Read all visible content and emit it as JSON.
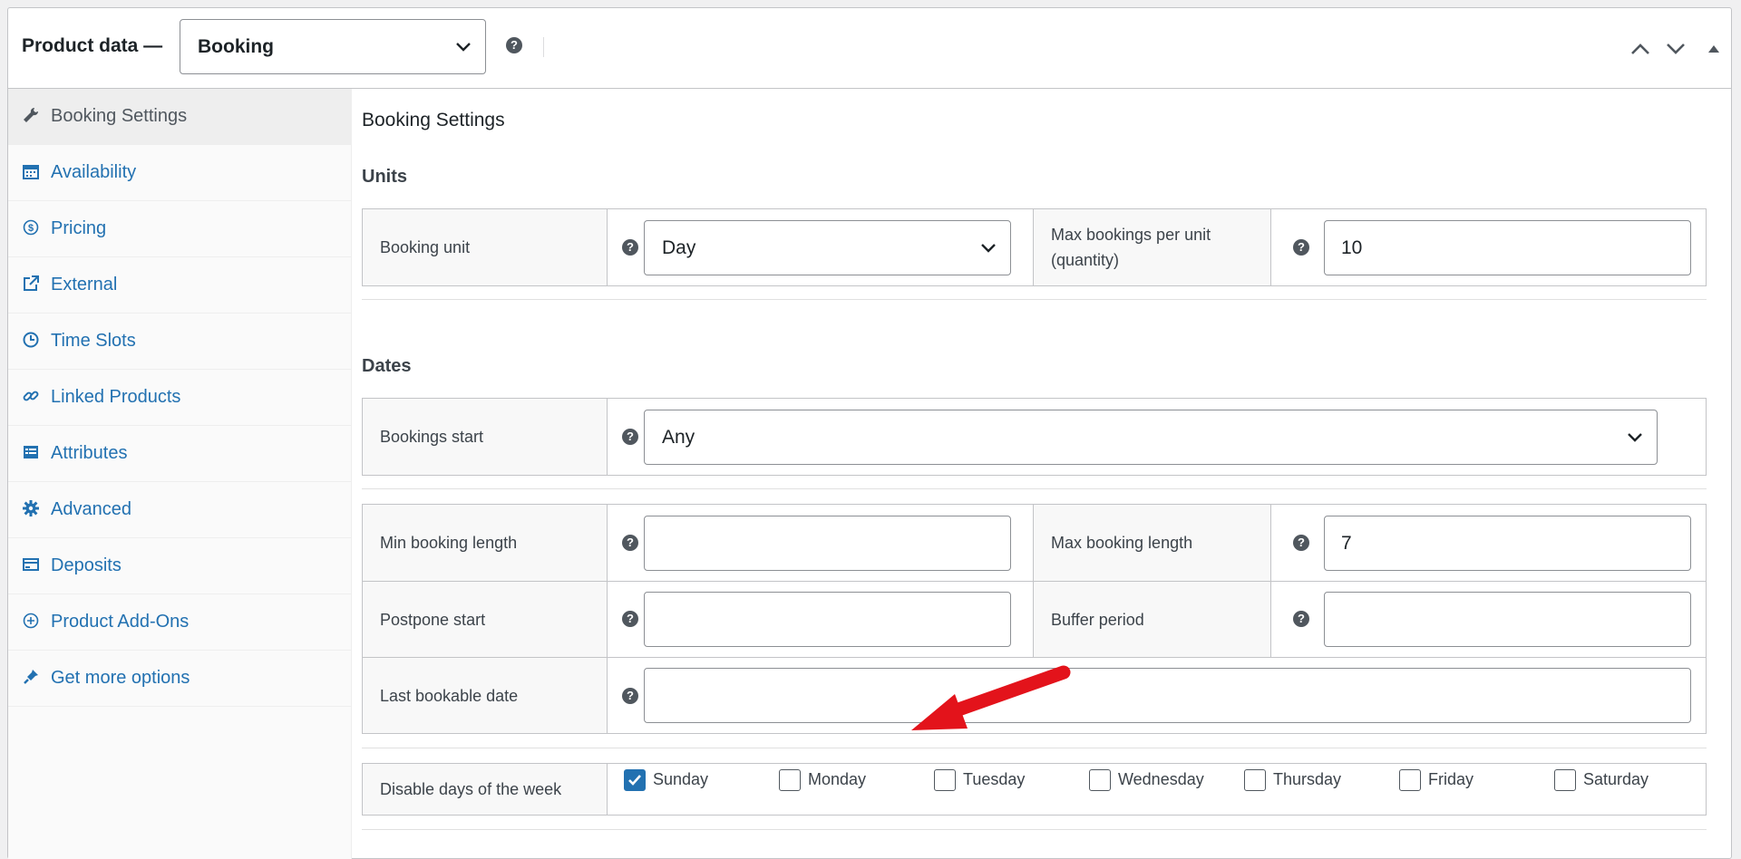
{
  "header": {
    "title": "Product data —",
    "product_type": "Booking"
  },
  "sidebar": {
    "items": [
      {
        "label": "Booking Settings",
        "icon": "wrench-icon",
        "active": true
      },
      {
        "label": "Availability",
        "icon": "calendar-icon"
      },
      {
        "label": "Pricing",
        "icon": "dollar-icon"
      },
      {
        "label": "External",
        "icon": "external-link-icon"
      },
      {
        "label": "Time Slots",
        "icon": "clock-icon"
      },
      {
        "label": "Linked Products",
        "icon": "link-icon"
      },
      {
        "label": "Attributes",
        "icon": "list-icon"
      },
      {
        "label": "Advanced",
        "icon": "gear-icon"
      },
      {
        "label": "Deposits",
        "icon": "credit-card-icon"
      },
      {
        "label": "Product Add-Ons",
        "icon": "plus-circle-icon"
      },
      {
        "label": "Get more options",
        "icon": "plugin-icon"
      }
    ]
  },
  "main": {
    "title": "Booking Settings",
    "units": {
      "heading": "Units",
      "booking_unit_label": "Booking unit",
      "booking_unit_value": "Day",
      "max_bookings_label": "Max bookings per unit (quantity)",
      "max_bookings_value": "10"
    },
    "dates": {
      "heading": "Dates",
      "bookings_start_label": "Bookings start",
      "bookings_start_value": "Any",
      "min_length_label": "Min booking length",
      "min_length_value": "",
      "max_length_label": "Max booking length",
      "max_length_value": "7",
      "postpone_label": "Postpone start",
      "postpone_value": "",
      "buffer_label": "Buffer period",
      "buffer_value": "",
      "last_date_label": "Last bookable date",
      "last_date_value": ""
    },
    "disable_days": {
      "label": "Disable days of the week",
      "days": [
        {
          "label": "Sunday",
          "checked": true
        },
        {
          "label": "Monday",
          "checked": false
        },
        {
          "label": "Tuesday",
          "checked": false
        },
        {
          "label": "Wednesday",
          "checked": false
        },
        {
          "label": "Thursday",
          "checked": false
        },
        {
          "label": "Friday",
          "checked": false
        },
        {
          "label": "Saturday",
          "checked": false
        }
      ]
    }
  },
  "colors": {
    "link": "#2271b1",
    "arrow": "#e3131b",
    "checkbox": "#2271b1"
  }
}
